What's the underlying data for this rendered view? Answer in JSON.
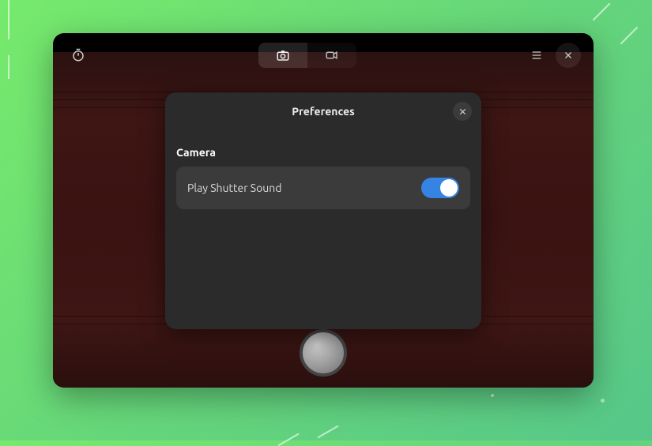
{
  "header": {
    "timer_icon": "timer-icon",
    "photo_mode_icon": "camera-icon",
    "video_mode_icon": "video-icon",
    "menu_icon": "hamburger-icon",
    "close_icon": "close-icon"
  },
  "preferences": {
    "title": "Preferences",
    "close_icon": "close-icon",
    "sections": [
      {
        "heading": "Camera",
        "rows": [
          {
            "label": "Play Shutter Sound",
            "toggle_on": true
          }
        ]
      }
    ]
  },
  "shutter": {
    "label": "shutter"
  },
  "colors": {
    "accent": "#3584e4"
  }
}
